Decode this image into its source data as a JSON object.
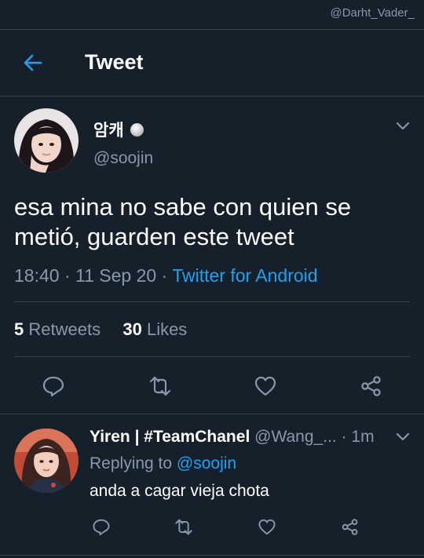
{
  "watermark": "@Darht_Vader_",
  "header": {
    "title": "Tweet"
  },
  "tweet": {
    "author_name": "암캐",
    "author_handle": "@soojin",
    "text": "esa mina no sabe con quien se metió, guarden este tweet",
    "time": "18:40",
    "date": "11 Sep 20",
    "source": "Twitter for Android",
    "retweets_count": "5",
    "retweets_label": "Retweets",
    "likes_count": "30",
    "likes_label": "Likes"
  },
  "reply": {
    "author_name": "Yiren | #TeamChanel",
    "author_handle": "@Wang_...",
    "time_ago": "1m",
    "replying_prefix": "Replying to",
    "replying_handle": "@soojin",
    "text": "anda a cagar vieja chota"
  },
  "icons": [
    "back-arrow-icon",
    "verified-badge-icon",
    "chevron-down-icon",
    "reply-icon",
    "retweet-icon",
    "like-icon",
    "share-icon"
  ],
  "colors": {
    "background": "#15202b",
    "accent": "#1da1f2",
    "muted": "#8899a6",
    "divider": "#38444d"
  }
}
